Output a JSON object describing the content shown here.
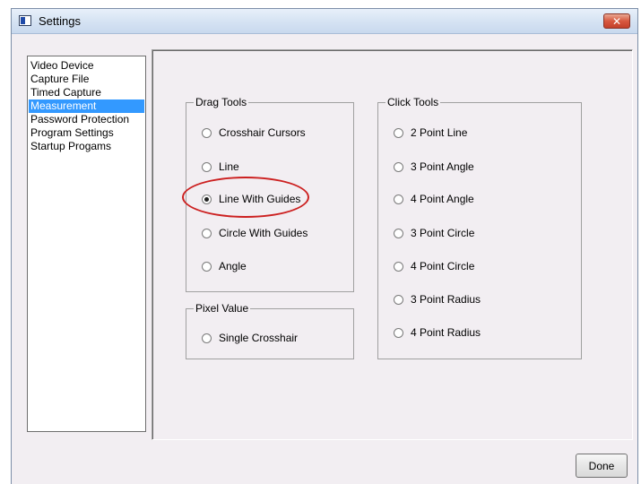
{
  "window": {
    "title": "Settings",
    "close_glyph": "✕"
  },
  "sidebar": {
    "items": [
      {
        "label": "Video Device",
        "selected": false
      },
      {
        "label": "Capture File",
        "selected": false
      },
      {
        "label": "Timed Capture",
        "selected": false
      },
      {
        "label": "Measurement",
        "selected": true
      },
      {
        "label": "Password Protection",
        "selected": false
      },
      {
        "label": "Program Settings",
        "selected": false
      },
      {
        "label": "Startup Progams",
        "selected": false
      }
    ]
  },
  "drag_tools": {
    "title": "Drag Tools",
    "options": [
      {
        "label": "Crosshair Cursors",
        "checked": false
      },
      {
        "label": "Line",
        "checked": false
      },
      {
        "label": "Line With Guides",
        "checked": true
      },
      {
        "label": "Circle With Guides",
        "checked": false
      },
      {
        "label": "Angle",
        "checked": false
      }
    ]
  },
  "pixel_value": {
    "title": "Pixel Value",
    "options": [
      {
        "label": "Single Crosshair",
        "checked": false
      }
    ]
  },
  "click_tools": {
    "title": "Click Tools",
    "options": [
      {
        "label": "2 Point Line",
        "checked": false
      },
      {
        "label": "3 Point Angle",
        "checked": false
      },
      {
        "label": "4 Point Angle",
        "checked": false
      },
      {
        "label": "3 Point Circle",
        "checked": false
      },
      {
        "label": "4 Point Circle",
        "checked": false
      },
      {
        "label": "3 Point Radius",
        "checked": false
      },
      {
        "label": "4 Point Radius",
        "checked": false
      }
    ]
  },
  "footer": {
    "done_label": "Done"
  },
  "colors": {
    "selection": "#3399ff",
    "annotation": "#cc2020",
    "window_bg": "#f2eef2"
  }
}
